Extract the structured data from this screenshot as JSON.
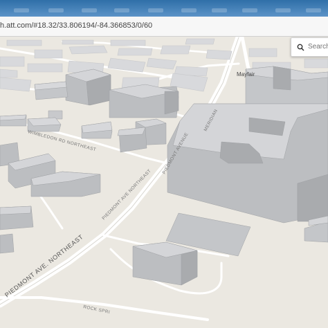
{
  "browser": {
    "url": "h.att.com/#18.32/33.806194/-84.366853/0/60"
  },
  "search": {
    "placeholder": "Search fo"
  },
  "map": {
    "place_labels": {
      "mayfair": "Mayfair"
    },
    "street_labels": {
      "wimbledon": "WIMBLEDON RD NORTHEAST",
      "piedmont_upper": "PIEDMONT AVE NORTHEAST",
      "piedmont_lower": "PIEDMONT AVE. NORTHEAST",
      "vertical_1": "PIEDMONT AVENUE",
      "vertical_2": "MERIDIAN",
      "rock_springs": "ROCK SPRI"
    },
    "colors": {
      "ground": "#ebe8e1",
      "road": "#ffffff",
      "building_top": "#d4d5d8",
      "building_side": "#a9abae",
      "building_front": "#bcbec1"
    }
  }
}
